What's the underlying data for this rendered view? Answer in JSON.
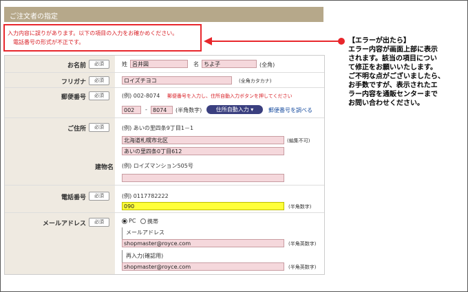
{
  "header": {
    "title": "ご注文者の指定"
  },
  "error": {
    "message": "入力内容に誤りがあります。以下の項目の入力をお確かめください。",
    "detail": "電話番号の形式が不正です。"
  },
  "note": {
    "title": "【エラーが出たら】",
    "lines": [
      "エラー内容が画面上部に表示",
      "されます。該当の項目につい",
      "て修正をお願いいたします。",
      "ご不明な点がございましたら、",
      "お手数ですが、表示されたエ",
      "ラー内容を通販センターまで",
      "お問い合わせください。"
    ]
  },
  "form": {
    "required": "必須",
    "name": {
      "label": "お名前",
      "sei": "姓",
      "sei_value": "呂井図",
      "mei": "名",
      "mei_value": "ちよ子",
      "note": "(全角)"
    },
    "furigana": {
      "label": "フリガナ",
      "value": "ロイズチヨコ",
      "note": "(全角カタカナ)"
    },
    "postal": {
      "label": "郵便番号",
      "example": "(例) 002-8074",
      "hint": "郵便番号を入力し、住所自動入力ボタンを押してください",
      "v1": "002",
      "dash": "-",
      "v2": "8074",
      "note": "(半角数字)",
      "auto_button": "住所自動入力",
      "lookup_link": "郵便番号を調べる"
    },
    "address": {
      "label": "ご住所",
      "example": "(例) あいの里四条9丁目1－1",
      "line1": "北海道札幌市北区",
      "line1_note": "(編集不可)",
      "line2": "あいの里四条0丁目612"
    },
    "building": {
      "label": "建物名",
      "example": "(例) ロイズマンション505号",
      "value": ""
    },
    "phone": {
      "label": "電話番号",
      "example": "(例) 0117782222",
      "value": "090",
      "note": "(半角数字)"
    },
    "email": {
      "label": "メールアドレス",
      "pc": "PC",
      "mobile": "携帯",
      "addr_label": "メールアドレス",
      "value": "shopmaster@royce.com",
      "note": "(半角英数字)",
      "confirm_label": "再入力(確認用)",
      "confirm_value": "shopmaster@royce.com",
      "confirm_note": "(半角英数字)"
    }
  }
}
